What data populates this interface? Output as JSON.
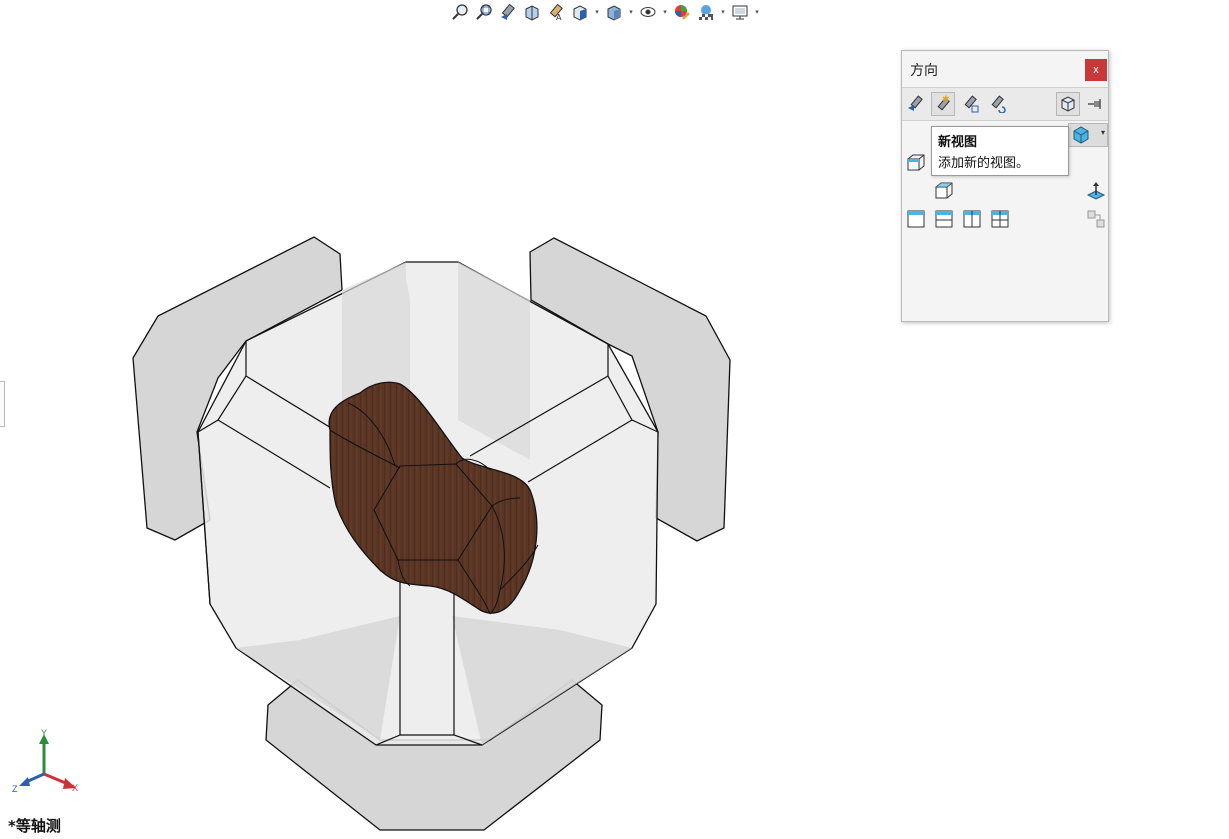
{
  "toolbar": {
    "items": [
      {
        "icon": "zoom-to-fit-icon",
        "dropdown": false
      },
      {
        "icon": "zoom-to-area-icon",
        "dropdown": false
      },
      {
        "icon": "previous-view-icon",
        "dropdown": false
      },
      {
        "icon": "section-view-icon",
        "dropdown": false
      },
      {
        "icon": "dynamic-annotation-icon",
        "dropdown": false
      },
      {
        "icon": "view-orientation-icon",
        "dropdown": true
      },
      {
        "icon": "display-style-icon",
        "dropdown": true
      },
      {
        "icon": "hide-show-items-icon",
        "dropdown": true
      },
      {
        "icon": "edit-appearance-icon",
        "dropdown": false
      },
      {
        "icon": "apply-scene-icon",
        "dropdown": true
      },
      {
        "icon": "view-settings-icon",
        "dropdown": true
      }
    ],
    "dropdown_glyph": "▾"
  },
  "orientation_panel": {
    "title": "方向",
    "close_label": "x",
    "tools": [
      {
        "icon": "previous-view-icon"
      },
      {
        "icon": "new-view-icon",
        "active": true
      },
      {
        "icon": "update-standard-views-icon"
      },
      {
        "icon": "reset-standard-views-icon"
      },
      {
        "icon": "view-selector-icon",
        "active": true
      },
      {
        "icon": "pin-icon"
      }
    ],
    "views": [
      {
        "icon": "isometric-view-icon"
      },
      {
        "icon": "single-view-icon"
      },
      {
        "icon": "two-view-horizontal-icon"
      },
      {
        "icon": "two-view-vertical-icon"
      },
      {
        "icon": "four-view-icon"
      },
      {
        "icon": "normal-to-icon"
      },
      {
        "icon": "link-views-icon"
      }
    ]
  },
  "tooltip": {
    "title": "新视图",
    "body": "添加新的视图。"
  },
  "view_label": "*等轴测",
  "triad": {
    "x_label": "X",
    "y_label": "Y",
    "z_label": "Z"
  },
  "colors": {
    "part_wood": "#5a3524",
    "selector_face": "#d8d8d8",
    "selector_cube": "#e9e9e9",
    "close_button": "#c8383b",
    "axis_x": "#d0303a",
    "axis_y": "#2e8b3c",
    "axis_z": "#2b5fb0"
  }
}
